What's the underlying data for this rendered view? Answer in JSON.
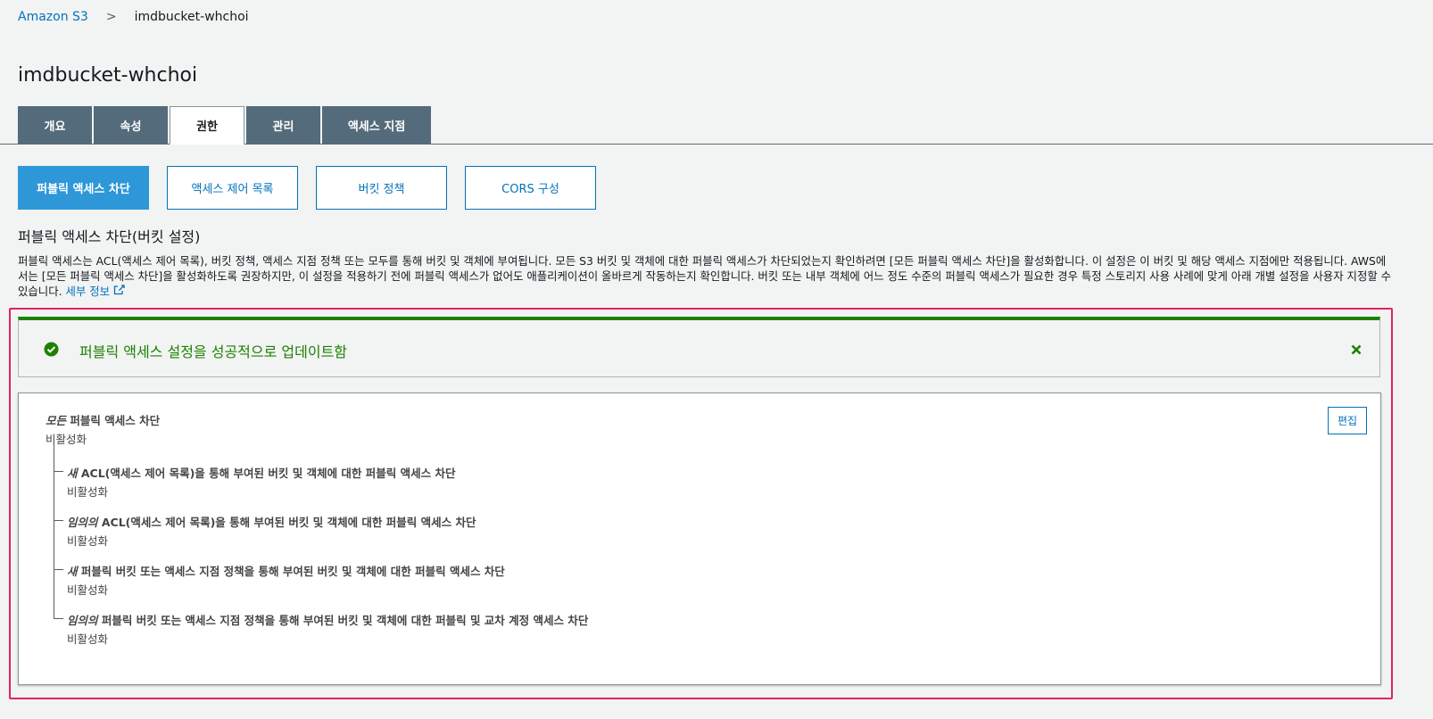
{
  "breadcrumb": {
    "root": "Amazon S3",
    "separator": ">",
    "current": "imdbucket-whchoi"
  },
  "page_title": "imdbucket-whchoi",
  "tabs": [
    {
      "label": "개요",
      "active": false
    },
    {
      "label": "속성",
      "active": false
    },
    {
      "label": "권한",
      "active": true
    },
    {
      "label": "관리",
      "active": false
    },
    {
      "label": "액세스 지점",
      "active": false
    }
  ],
  "subtabs": [
    {
      "label": "퍼블릭 액세스 차단",
      "active": true
    },
    {
      "label": "액세스 제어 목록",
      "active": false
    },
    {
      "label": "버킷 정책",
      "active": false
    },
    {
      "label": "CORS 구성",
      "active": false
    }
  ],
  "section": {
    "title": "퍼블릭 액세스 차단(버킷 설정)",
    "description": "퍼블릭 액세스는 ACL(액세스 제어 목록), 버킷 정책, 액세스 지점 정책 또는 모두를 통해 버킷 및 객체에 부여됩니다. 모든 S3 버킷 및 객체에 대한 퍼블릭 액세스가 차단되었는지 확인하려면 [모든 퍼블릭 액세스 차단]을 활성화합니다. 이 설정은 이 버킷 및 해당 액세스 지점에만 적용됩니다. AWS에서는 [모든 퍼블릭 액세스 차단]을 활성화하도록 권장하지만, 이 설정을 적용하기 전에 퍼블릭 액세스가 없어도 애플리케이션이 올바르게 작동하는지 확인합니다. 버킷 또는 내부 객체에 어느 정도 수준의 퍼블릭 액세스가 필요한 경우 특정 스토리지 사용 사례에 맞게 아래 개별 설정을 사용자 지정할 수 있습니다.",
    "learn_more": "세부 정보"
  },
  "alert": {
    "message": "퍼블릭 액세스 설정을 성공적으로 업데이트함",
    "color": "#1d8102"
  },
  "panel": {
    "edit_label": "편집",
    "main": {
      "prefix": "모든",
      "title": " 퍼블릭 액세스 차단",
      "value": "비활성화"
    },
    "settings": [
      {
        "prefix": "새",
        "title": " ACL(액세스 제어 목록)을 통해 부여된 버킷 및 객체에 대한 퍼블릭 액세스 차단",
        "value": "비활성화"
      },
      {
        "prefix": "임의의",
        "title": " ACL(액세스 제어 목록)을 통해 부여된 버킷 및 객체에 대한 퍼블릭 액세스 차단",
        "value": "비활성화"
      },
      {
        "prefix": "새",
        "title": " 퍼블릭 버킷 또는 액세스 지점 정책을 통해 부여된 버킷 및 객체에 대한 퍼블릭 액세스 차단",
        "value": "비활성화"
      },
      {
        "prefix": "임의의",
        "title": " 퍼블릭 버킷 또는 액세스 지점 정책을 통해 부여된 버킷 및 객체에 대한 퍼블릭 및 교차 계정 액세스 차단",
        "value": "비활성화"
      }
    ]
  },
  "colors": {
    "accent": "#0073bb",
    "tab_bg": "#546b7b",
    "subtab_active": "#2e97d8",
    "highlight": "#e0245e"
  }
}
